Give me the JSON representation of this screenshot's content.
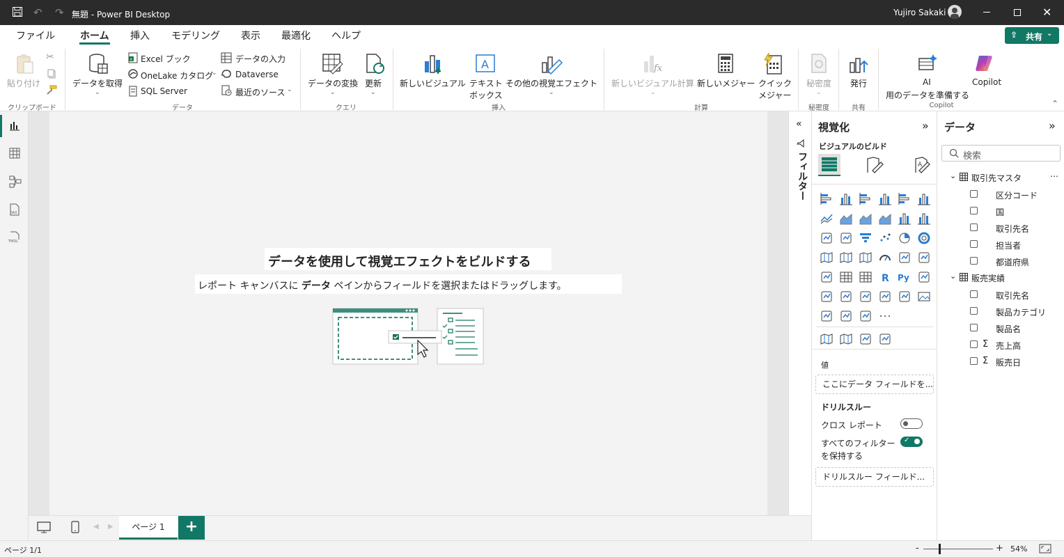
{
  "window": {
    "title": "無題 - Power BI Desktop",
    "user": "Yujiro Sakaki"
  },
  "tabs": [
    "ファイル",
    "ホーム",
    "挿入",
    "モデリング",
    "表示",
    "最適化",
    "ヘルプ"
  ],
  "share_label": "共有",
  "ribbon": {
    "clipboard": {
      "paste": "貼り付け",
      "group": "クリップボード"
    },
    "data": {
      "get_data": "データを取得",
      "excel": "Excel ブック",
      "onelake": "OneLake カタログ",
      "sql": "SQL Server",
      "enter_data": "データの入力",
      "dataverse": "Dataverse",
      "recent": "最近のソース",
      "group": "データ"
    },
    "query": {
      "transform": "データの変換",
      "refresh": "更新",
      "group": "クエリ"
    },
    "insert": {
      "new_visual": "新しいビジュアル",
      "textbox_1": "テキスト",
      "textbox_2": "ボックス",
      "more_visuals": "その他の視覚エフェクト",
      "group": "挿入"
    },
    "calc": {
      "new_visual_calc": "新しいビジュアル計算",
      "new_measure": "新しいメジャー",
      "quick_1": "クイック",
      "quick_2": "メジャー",
      "group": "計算"
    },
    "sensitivity": {
      "label": "秘密度",
      "group": "秘密度"
    },
    "share": {
      "publish": "発行",
      "group": "共有"
    },
    "copilot": {
      "ai_1": "AI",
      "ai_2": "用のデータを準備する",
      "copilot": "Copilot",
      "group": "Copilot"
    }
  },
  "canvas": {
    "heading": "データを使用して視覚エフェクトをビルドする",
    "sub_1": "レポート キャンバスに",
    "sub_bold": "データ",
    "sub_2": "ペインからフィールドを選択またはドラッグします。"
  },
  "pages": {
    "tab": "ページ 1"
  },
  "filters_label": "フィルター",
  "viz": {
    "title": "視覚化",
    "build": "ビジュアルのビルド",
    "values_label": "値",
    "values_placeholder": "ここにデータ フィールドを...",
    "drillthrough": "ドリルスルー",
    "cross_report": "クロス レポート",
    "cross_report_on": false,
    "keep_filters_1": "すべてのフィルター",
    "keep_filters_2": "を保持する",
    "keep_filters_on": true,
    "drill_placeholder": "ドリルスルー フィールド..."
  },
  "data_pane": {
    "title": "データ",
    "search_placeholder": "検索",
    "tables": [
      {
        "name": "取引先マスタ",
        "fields": [
          {
            "name": "区分コード",
            "sigma": false
          },
          {
            "name": "国",
            "sigma": false
          },
          {
            "name": "取引先名",
            "sigma": false
          },
          {
            "name": "担当者",
            "sigma": false
          },
          {
            "name": "都道府県",
            "sigma": false
          }
        ]
      },
      {
        "name": "販売実績",
        "fields": [
          {
            "name": "取引先名",
            "sigma": false
          },
          {
            "name": "製品カテゴリ",
            "sigma": false
          },
          {
            "name": "製品名",
            "sigma": false
          },
          {
            "name": "売上高",
            "sigma": true
          },
          {
            "name": "販売日",
            "sigma": true
          }
        ]
      }
    ]
  },
  "status": {
    "page": "ページ 1/1",
    "zoom": "54%"
  },
  "colors": {
    "accent": "#117865",
    "titlebar": "#2b2b2b",
    "viz_blue": "#2b7cd3"
  }
}
